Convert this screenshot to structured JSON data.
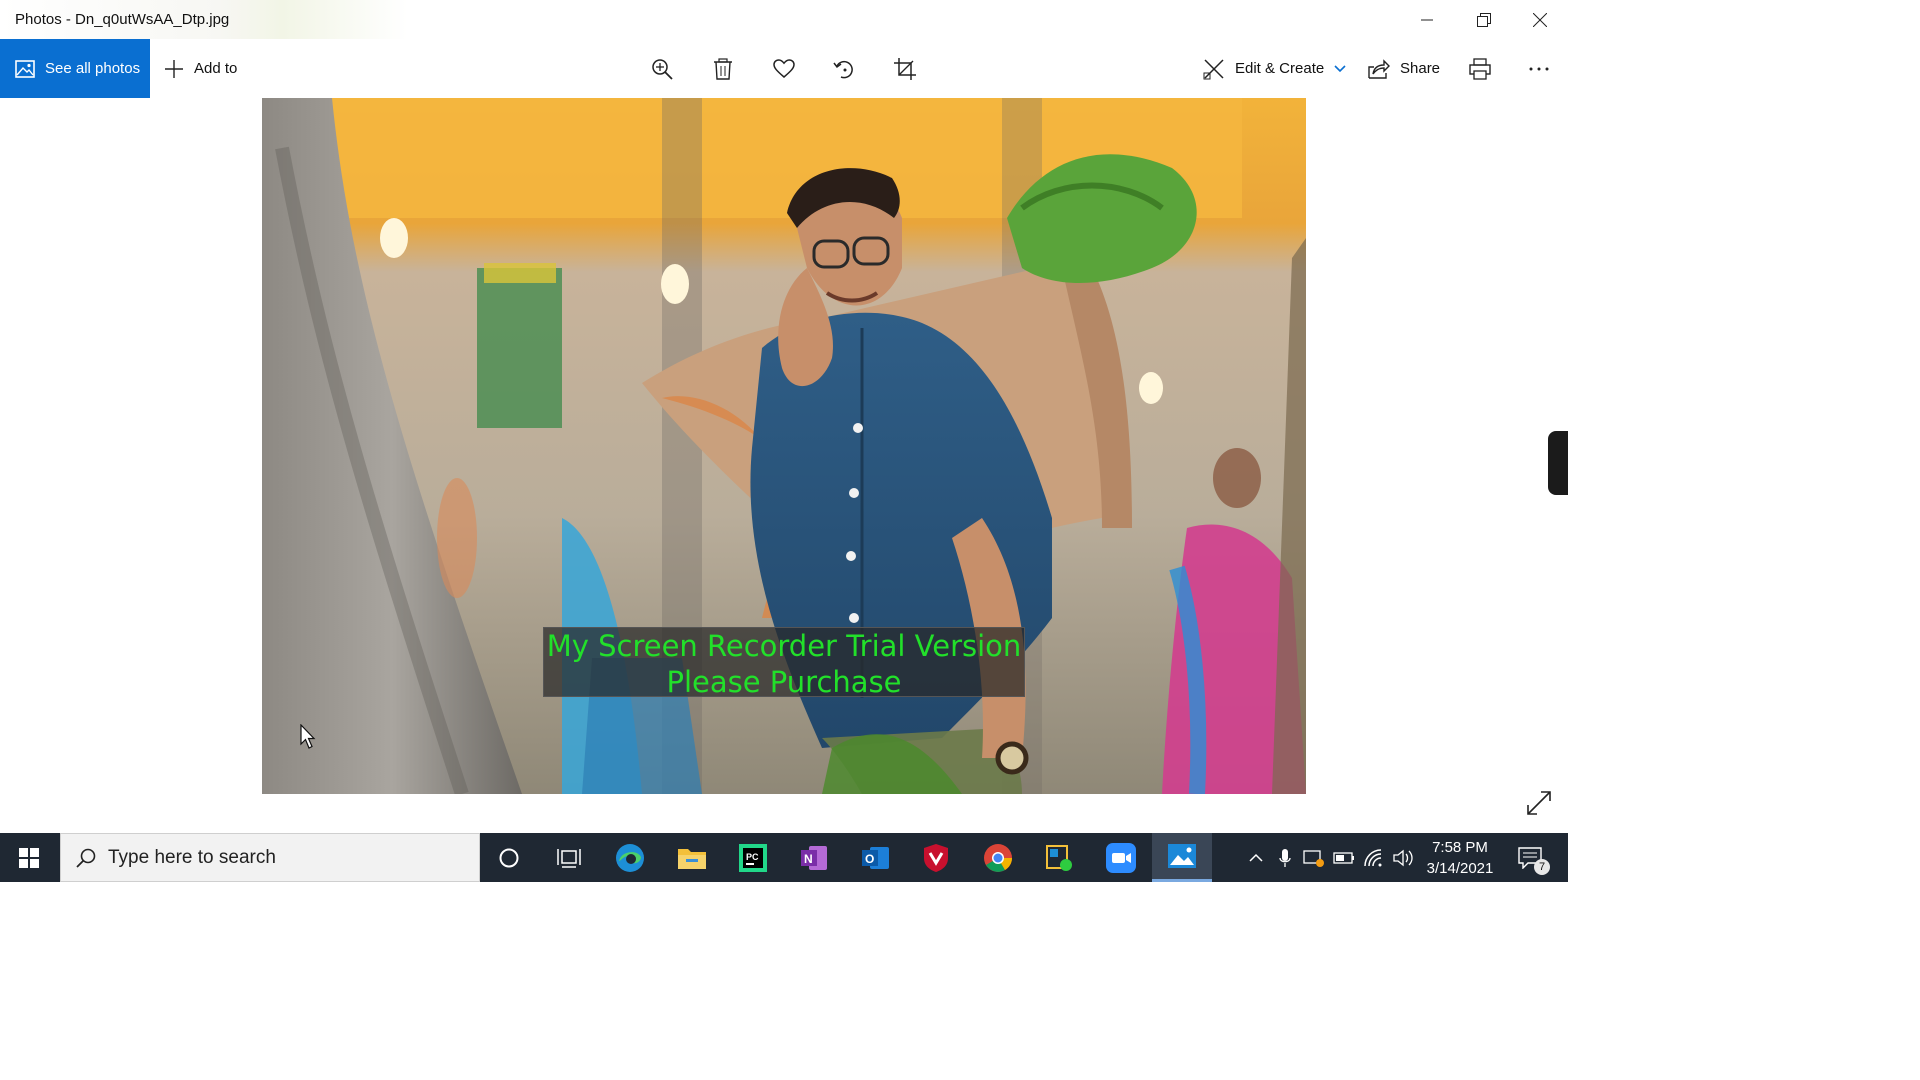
{
  "window": {
    "title": "Photos - Dn_q0utWsAA_Dtp.jpg"
  },
  "toolbar": {
    "see_all_label": "See all photos",
    "add_to_label": "Add to",
    "edit_create_label": "Edit & Create",
    "share_label": "Share",
    "icons": [
      "zoom-icon",
      "delete-icon",
      "favorite-icon",
      "rotate-icon",
      "crop-icon",
      "print-icon",
      "more-icon"
    ]
  },
  "photo": {
    "watermark_line1": "My Screen Recorder Trial Version",
    "watermark_line2": "Please Purchase"
  },
  "taskbar": {
    "search_placeholder": "Type here to search",
    "apps": [
      "cortana",
      "task-view",
      "edge",
      "file-explorer",
      "pycharm",
      "onenote",
      "outlook",
      "mcafee",
      "chrome",
      "shared-files",
      "zoom",
      "photos"
    ],
    "time": "7:58 PM",
    "date": "3/14/2021",
    "notification_count": "7"
  },
  "colors": {
    "accent": "#0a6fd1",
    "taskbar": "#1f2833",
    "watermark_text": "#22e02a"
  }
}
